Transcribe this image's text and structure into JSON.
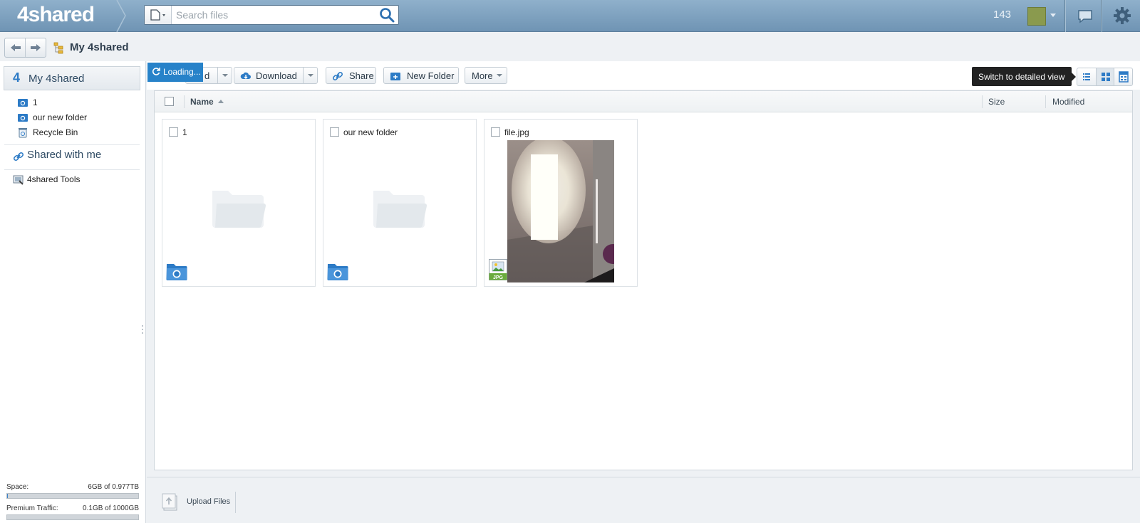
{
  "header": {
    "logo_text": "4shared",
    "search_placeholder": "Search files",
    "counter": "143"
  },
  "breadcrumb": {
    "title": "My 4shared"
  },
  "sidebar": {
    "root_label": "My 4shared",
    "tree": [
      {
        "label": "1",
        "icon": "shared-folder-icon"
      },
      {
        "label": "our new folder",
        "icon": "shared-folder-icon"
      },
      {
        "label": "Recycle Bin",
        "icon": "recycle-bin-icon"
      }
    ],
    "shared_with_me": "Shared with me",
    "tools": "4shared Tools",
    "space": {
      "label": "Space:",
      "value": "6GB of 0.977TB",
      "fraction": 0.006
    },
    "traffic": {
      "label": "Premium Traffic:",
      "value": "0.1GB of 1000GB",
      "fraction": 0.0001
    }
  },
  "toolbar": {
    "upload_partial": "d",
    "loading": "Loading...",
    "download": "Download",
    "share": "Share",
    "new_folder": "New Folder",
    "more": "More",
    "tooltip": "Switch to detailed view"
  },
  "columns": {
    "name": "Name",
    "size": "Size",
    "modified": "Modified"
  },
  "files": [
    {
      "name": "1",
      "type": "folder"
    },
    {
      "name": "our new folder",
      "type": "folder"
    },
    {
      "name": "file.jpg",
      "type": "image",
      "badge": "JPG"
    }
  ],
  "bottom": {
    "upload_files": "Upload Files"
  },
  "colors": {
    "accent": "#2782c9",
    "topbar": "#7fa2bf"
  }
}
